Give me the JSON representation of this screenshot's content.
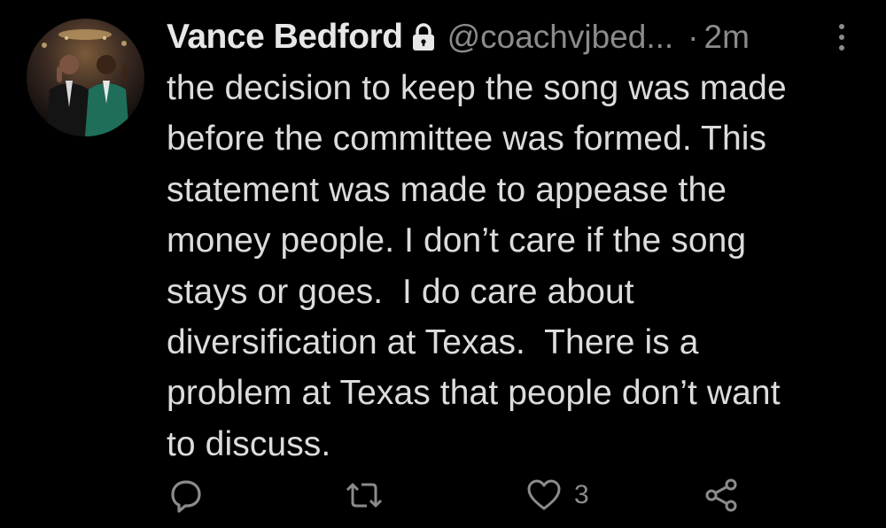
{
  "tweet": {
    "display_name": "Vance Bedford",
    "handle": "@coachvjbed...",
    "separator": "·",
    "time": "2m",
    "protected_icon": "lock-icon",
    "more_icon": "more-vertical-icon",
    "text_lines": [
      "the decision to keep the song was made",
      "before the committee was formed. This",
      "statement was made to appease the",
      "money people. I don’t care if the song",
      "stays or goes.  I do care about",
      "diversification at Texas.  There is a",
      "problem at Texas that people don’t want",
      "to discuss."
    ],
    "actions": {
      "reply_icon": "reply-icon",
      "retweet_icon": "retweet-icon",
      "like_icon": "heart-icon",
      "like_count": "3",
      "share_icon": "share-icon"
    }
  },
  "colors": {
    "background": "#000000",
    "name": "#e7e7e7",
    "text": "#dcdcdc",
    "muted": "#8b8b8b"
  }
}
